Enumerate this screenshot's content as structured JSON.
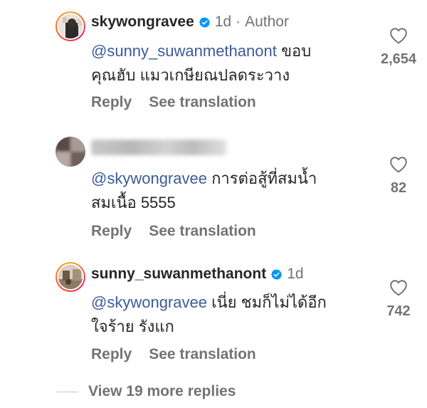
{
  "comments": [
    {
      "username": "skywongravee",
      "verified": true,
      "time": "1d",
      "separator": "·",
      "author_tag": "Author",
      "mention": "@sunny_suwanmethanont",
      "text_line1": " ขอบ",
      "text_line2": "คุณฮับ แมวเกษียณปลดระวาง",
      "reply_label": "Reply",
      "translate_label": "See translation",
      "like_count": "2,654"
    },
    {
      "username_hidden": true,
      "mention": "@skywongravee",
      "text_line1": " การต่อสู้ที่สมน้ำ",
      "text_line2": "สมเนื้อ 5555",
      "reply_label": "Reply",
      "translate_label": "See translation",
      "like_count": "82"
    },
    {
      "username": "sunny_suwanmethanont",
      "verified": true,
      "time": "1d",
      "mention": "@skywongravee",
      "text_line1": " เนี่ย ชมก็ไม่ได้อีก",
      "text_line2": "ใจร้าย รังแก",
      "reply_label": "Reply",
      "translate_label": "See translation",
      "like_count": "742"
    }
  ],
  "view_more_label": "View 19 more replies",
  "icons": {
    "verified": "verified-badge-icon",
    "like": "heart-outline-icon"
  },
  "colors": {
    "mention": "#3b5b9a",
    "verified": "#0095f6",
    "muted": "#737373"
  }
}
